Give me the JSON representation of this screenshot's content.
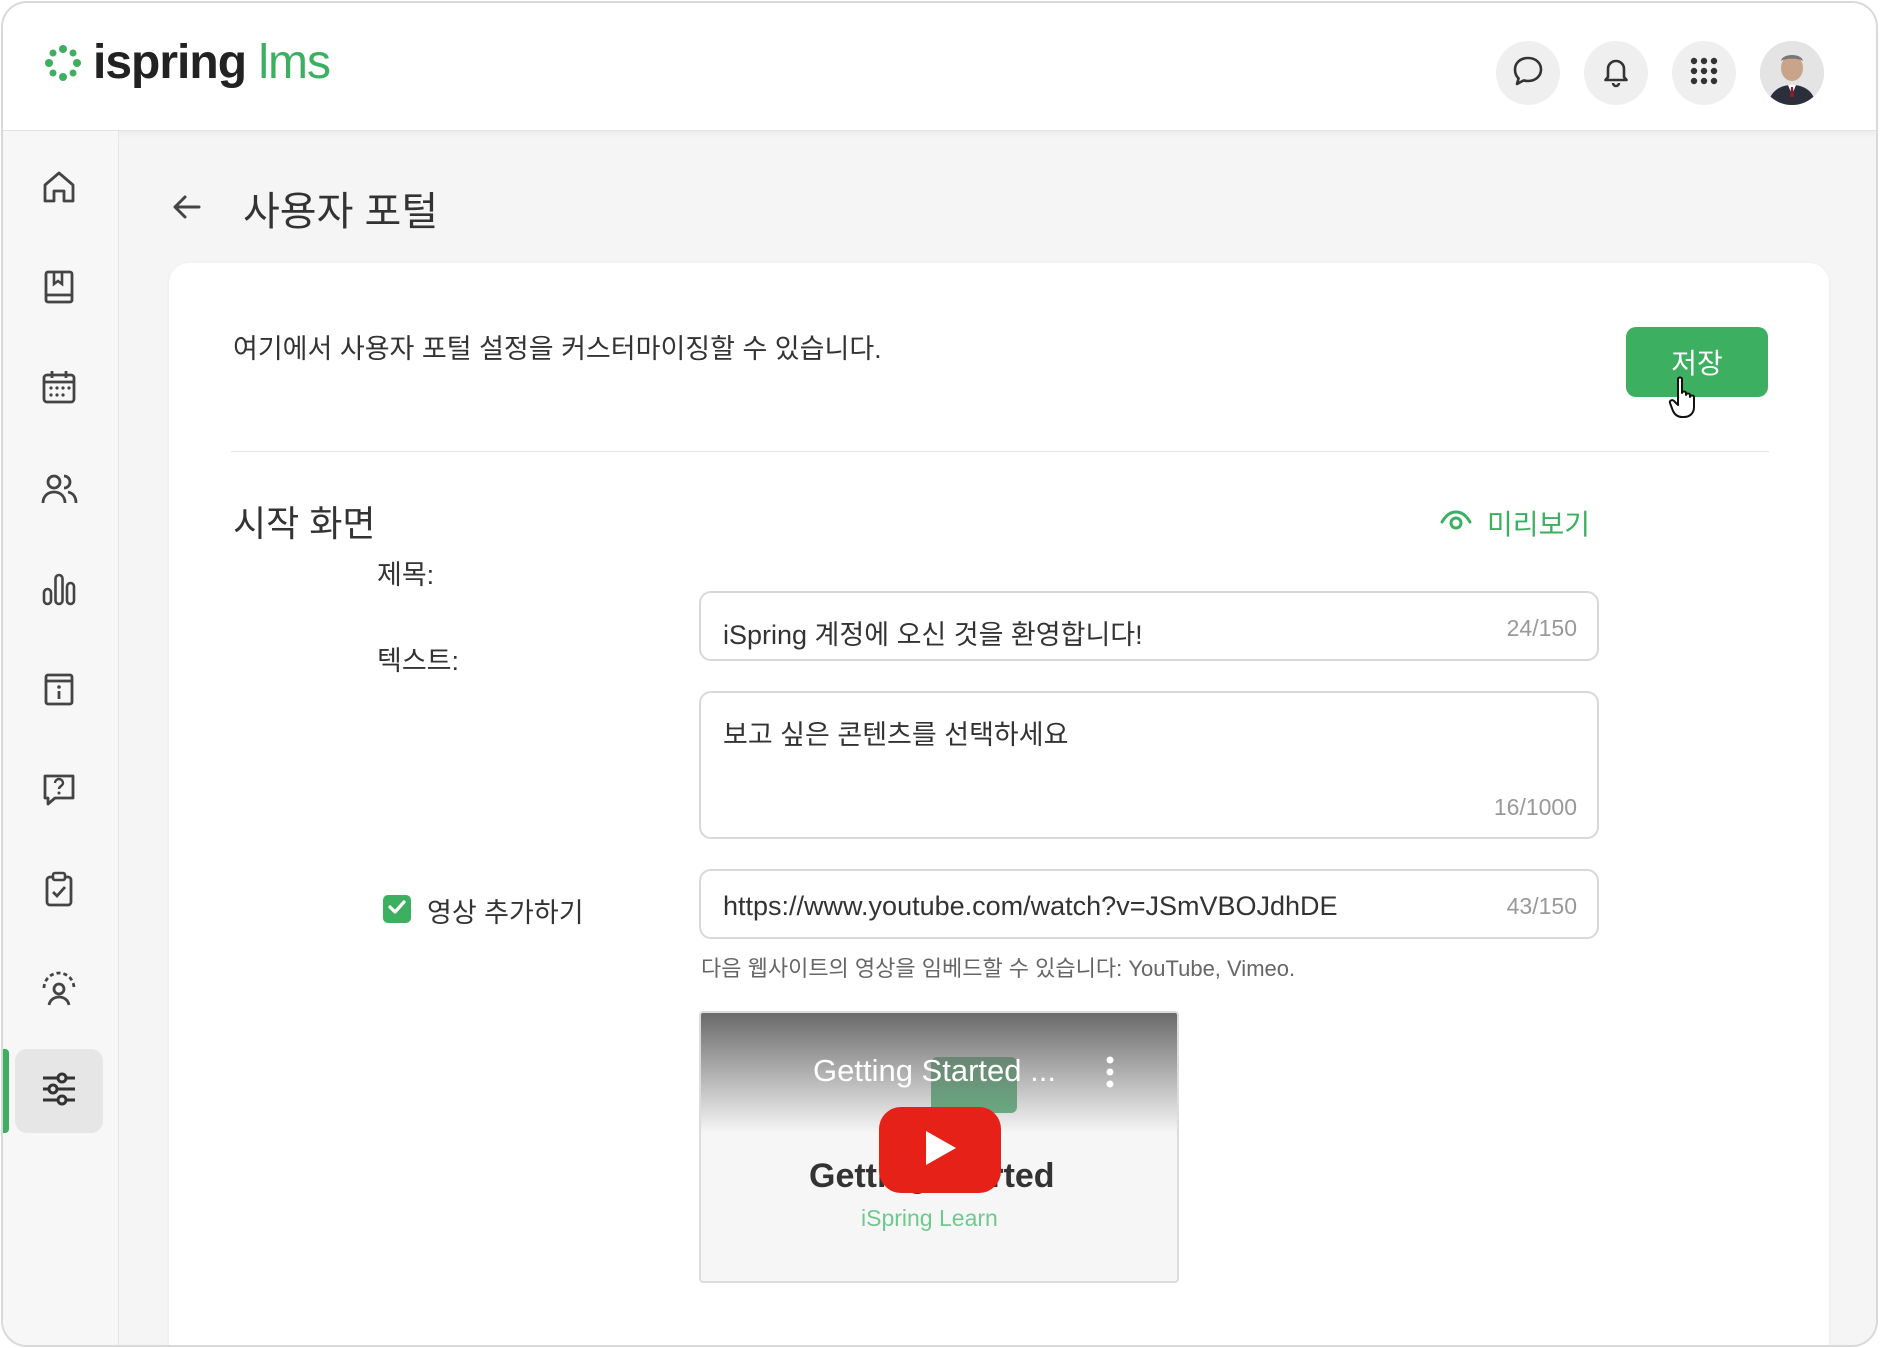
{
  "app": {
    "logo_primary": "ispring",
    "logo_secondary": "lms"
  },
  "header": {
    "icons": [
      "chat-icon",
      "bell-icon",
      "apps-grid-icon"
    ],
    "accent_color": "#3daf60"
  },
  "sidebar": {
    "items": [
      "home-icon",
      "book-icon",
      "calendar-icon",
      "users-icon",
      "chart-icon",
      "info-board-icon",
      "help-chat-icon",
      "clipboard-icon",
      "user-support-icon",
      "settings-sliders-icon"
    ],
    "active_index": 9
  },
  "page": {
    "title": "사용자 포털"
  },
  "card": {
    "intro": "여기에서 사용자 포털 설정을 커스터마이징할 수 있습니다.",
    "save_label": "저장"
  },
  "section": {
    "title": "시작 화면",
    "preview_label": "미리보기",
    "title_label": "제목:",
    "title_value": "iSpring 계정에 오신 것을 환영합니다!",
    "title_counter": "24/150",
    "text_label": "텍스트:",
    "text_value": "보고 싶은 콘텐츠를 선택하세요",
    "text_counter": "16/1000",
    "video_checkbox_label": "영상 추가하기",
    "video_checked": true,
    "video_url": "https://www.youtube.com/watch?v=JSmVBOJdhDE",
    "video_counter": "43/150",
    "video_hint": "다음 웹사이트의 영상을 임베드할 수 있습니다: YouTube, Vimeo."
  },
  "video_preview": {
    "title": "Getting Started ...",
    "big_text": "Getting Started",
    "sub_text": "iSpring Learn"
  }
}
